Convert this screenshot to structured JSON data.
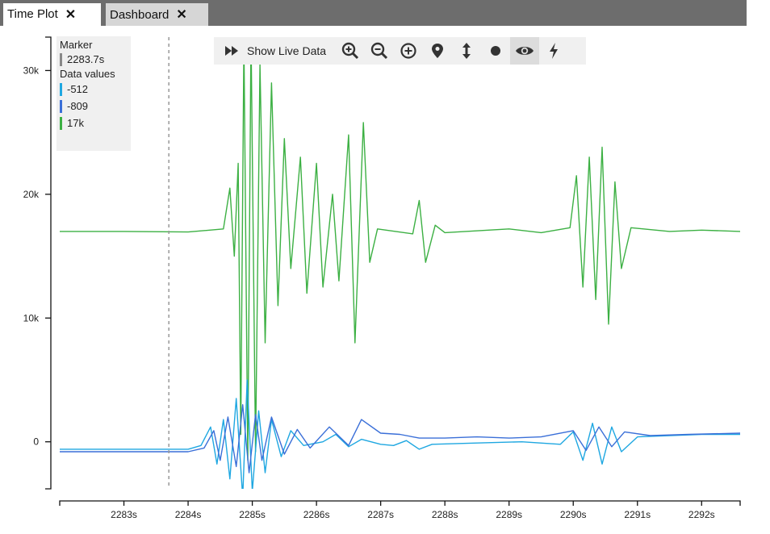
{
  "tabs": [
    {
      "label": "Time Plot",
      "active": true
    },
    {
      "label": "Dashboard",
      "active": false
    }
  ],
  "toolbar": {
    "live_label": "Show Live Data",
    "icons": [
      "fast-forward-icon",
      "zoom-in-icon",
      "zoom-out-icon",
      "zoom-reset-icon",
      "marker-pin-icon",
      "vertical-arrows-icon",
      "dot-icon",
      "eye-icon",
      "lightning-icon"
    ]
  },
  "legend": {
    "marker_title": "Marker",
    "marker_value": "2283.7s",
    "marker_color": "#888888",
    "values_title": "Data values",
    "values": [
      {
        "label": "-512",
        "color": "#1ea7e1"
      },
      {
        "label": "-809",
        "color": "#3a6fd8"
      },
      {
        "label": "17k",
        "color": "#3cb043"
      }
    ]
  },
  "chart_data": {
    "type": "line",
    "x_ticks": [
      "2283s",
      "2284s",
      "2285s",
      "2286s",
      "2287s",
      "2288s",
      "2289s",
      "2290s",
      "2291s",
      "2292s"
    ],
    "y_ticks": [
      "0",
      "10k",
      "20k",
      "30k"
    ],
    "xlim": [
      2282.0,
      2292.6
    ],
    "ylim": [
      -3800,
      32700
    ],
    "marker_x": 2283.7,
    "series": [
      {
        "color": "#3cb043",
        "points": [
          [
            2282.0,
            17000
          ],
          [
            2283.0,
            17000
          ],
          [
            2284.0,
            16950
          ],
          [
            2284.55,
            17200
          ],
          [
            2284.65,
            20500
          ],
          [
            2284.72,
            15000
          ],
          [
            2284.78,
            22500
          ],
          [
            2284.82,
            600
          ],
          [
            2284.87,
            32500
          ],
          [
            2284.93,
            -1500
          ],
          [
            2284.98,
            33000
          ],
          [
            2285.05,
            -800
          ],
          [
            2285.12,
            30500
          ],
          [
            2285.2,
            8000
          ],
          [
            2285.3,
            29000
          ],
          [
            2285.4,
            11000
          ],
          [
            2285.5,
            24500
          ],
          [
            2285.6,
            14000
          ],
          [
            2285.75,
            23000
          ],
          [
            2285.85,
            12000
          ],
          [
            2286.0,
            22500
          ],
          [
            2286.1,
            12500
          ],
          [
            2286.25,
            20000
          ],
          [
            2286.35,
            13000
          ],
          [
            2286.5,
            24800
          ],
          [
            2286.6,
            8000
          ],
          [
            2286.73,
            25800
          ],
          [
            2286.83,
            14500
          ],
          [
            2286.95,
            17200
          ],
          [
            2287.5,
            16800
          ],
          [
            2287.6,
            19500
          ],
          [
            2287.7,
            14500
          ],
          [
            2287.85,
            17500
          ],
          [
            2288.0,
            16900
          ],
          [
            2289.0,
            17200
          ],
          [
            2289.5,
            16900
          ],
          [
            2289.95,
            17300
          ],
          [
            2290.05,
            21500
          ],
          [
            2290.15,
            12500
          ],
          [
            2290.25,
            23000
          ],
          [
            2290.35,
            11500
          ],
          [
            2290.45,
            23800
          ],
          [
            2290.55,
            9500
          ],
          [
            2290.65,
            21000
          ],
          [
            2290.75,
            14000
          ],
          [
            2290.9,
            17300
          ],
          [
            2291.5,
            17000
          ],
          [
            2292.0,
            17100
          ],
          [
            2292.6,
            17000
          ]
        ]
      },
      {
        "color": "#1ea7e1",
        "points": [
          [
            2282.0,
            -600
          ],
          [
            2284.0,
            -600
          ],
          [
            2284.2,
            -300
          ],
          [
            2284.35,
            1200
          ],
          [
            2284.45,
            -1800
          ],
          [
            2284.55,
            1800
          ],
          [
            2284.65,
            -3000
          ],
          [
            2284.75,
            3500
          ],
          [
            2284.85,
            -4500
          ],
          [
            2284.92,
            5000
          ],
          [
            2285.0,
            -4000
          ],
          [
            2285.1,
            2500
          ],
          [
            2285.2,
            -2500
          ],
          [
            2285.3,
            1800
          ],
          [
            2285.45,
            -1200
          ],
          [
            2285.6,
            900
          ],
          [
            2285.8,
            -300
          ],
          [
            2286.1,
            0
          ],
          [
            2286.3,
            600
          ],
          [
            2286.5,
            -400
          ],
          [
            2286.7,
            200
          ],
          [
            2287.0,
            -200
          ],
          [
            2287.2,
            -300
          ],
          [
            2287.4,
            100
          ],
          [
            2287.6,
            -600
          ],
          [
            2287.8,
            -200
          ],
          [
            2288.5,
            -100
          ],
          [
            2289.2,
            0
          ],
          [
            2289.8,
            -200
          ],
          [
            2290.0,
            800
          ],
          [
            2290.15,
            -1500
          ],
          [
            2290.3,
            1500
          ],
          [
            2290.45,
            -1800
          ],
          [
            2290.6,
            1200
          ],
          [
            2290.75,
            -800
          ],
          [
            2291.0,
            400
          ],
          [
            2291.5,
            500
          ],
          [
            2292.0,
            600
          ],
          [
            2292.6,
            600
          ]
        ]
      },
      {
        "color": "#3a6fd8",
        "points": [
          [
            2282.0,
            -800
          ],
          [
            2284.0,
            -800
          ],
          [
            2284.25,
            -500
          ],
          [
            2284.4,
            900
          ],
          [
            2284.5,
            -1500
          ],
          [
            2284.62,
            2000
          ],
          [
            2284.75,
            -2000
          ],
          [
            2284.85,
            3000
          ],
          [
            2284.95,
            -2500
          ],
          [
            2285.05,
            2200
          ],
          [
            2285.15,
            -1500
          ],
          [
            2285.3,
            2000
          ],
          [
            2285.5,
            -1000
          ],
          [
            2285.7,
            1000
          ],
          [
            2285.9,
            -500
          ],
          [
            2286.2,
            1200
          ],
          [
            2286.5,
            -300
          ],
          [
            2286.7,
            1800
          ],
          [
            2287.0,
            700
          ],
          [
            2287.3,
            600
          ],
          [
            2287.6,
            300
          ],
          [
            2288.0,
            300
          ],
          [
            2288.5,
            400
          ],
          [
            2289.0,
            300
          ],
          [
            2289.5,
            400
          ],
          [
            2290.0,
            900
          ],
          [
            2290.2,
            -700
          ],
          [
            2290.4,
            1200
          ],
          [
            2290.6,
            -400
          ],
          [
            2290.8,
            800
          ],
          [
            2291.2,
            500
          ],
          [
            2291.8,
            600
          ],
          [
            2292.6,
            700
          ]
        ]
      }
    ]
  }
}
